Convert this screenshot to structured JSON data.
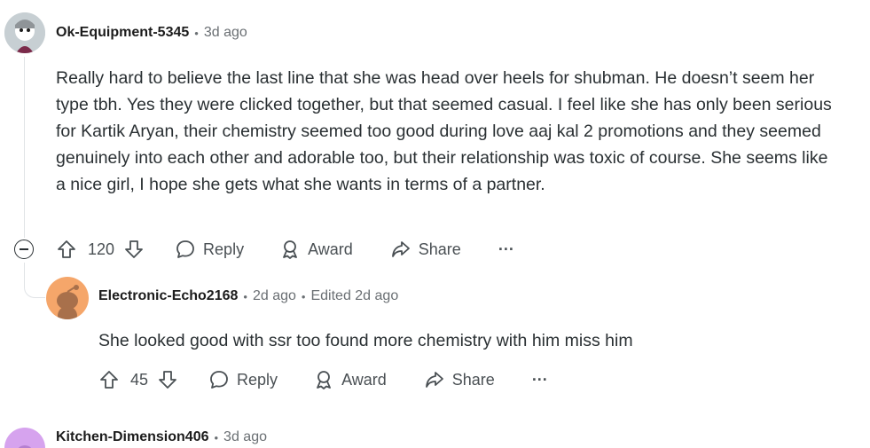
{
  "comments": [
    {
      "author": "Ok-Equipment-5345",
      "time": "3d ago",
      "body": "Really hard to believe the last line that she was head over heels for shubman. He doesn’t seem her type tbh. Yes they were clicked together, but that seemed casual. I feel like she has only been serious for Kartik Aryan, their chemistry seemed too good during love aaj kal 2 promotions and they seemed genuinely into each other and adorable too, but their relationship was toxic of course. She seems like a nice girl, I hope she gets what she wants in terms of a partner.",
      "votes": "120",
      "avatar_color": "#7a8a8f"
    },
    {
      "author": "Electronic-Echo2168",
      "time": "2d ago",
      "edited": "Edited 2d ago",
      "body": "She looked good with ssr too found more chemistry with him miss him",
      "votes": "45",
      "avatar_color": "#f5a66a"
    },
    {
      "author": "Kitchen-Dimension406",
      "time": "3d ago",
      "avatar_color": "#d6a3ee"
    }
  ],
  "actions": {
    "reply": "Reply",
    "award": "Award",
    "share": "Share",
    "more": "···"
  },
  "separator": "•"
}
